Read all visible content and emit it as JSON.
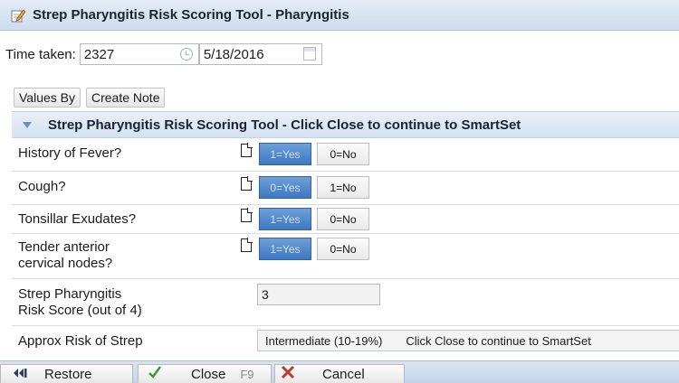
{
  "window": {
    "title": "Strep Pharyngitis Risk Scoring Tool - Pharyngitis"
  },
  "time": {
    "label": "Time taken:",
    "time_value": "2327",
    "date_value": "5/18/2016"
  },
  "toolbar": {
    "values_by": "Values By",
    "create_note": "Create Note"
  },
  "section": {
    "title": "Strep Pharyngitis Risk Scoring Tool - Click Close to continue to SmartSet"
  },
  "questions": [
    {
      "label": "History of Fever?",
      "opt1": "1=Yes",
      "opt2": "0=No",
      "selected": "opt1"
    },
    {
      "label": "Cough?",
      "opt1": "0=Yes",
      "opt2": "1=No",
      "selected": "opt1"
    },
    {
      "label": "Tonsillar Exudates?",
      "opt1": "1=Yes",
      "opt2": "0=No",
      "selected": "opt1"
    },
    {
      "label_line1": "Tender anterior",
      "label_line2": "cervical nodes?",
      "opt1": "1=Yes",
      "opt2": "0=No",
      "selected": "opt1"
    }
  ],
  "score": {
    "label_line1": "Strep Pharyngitis",
    "label_line2": "Risk Score (out of 4)",
    "value": "3"
  },
  "risk": {
    "label": "Approx Risk of Strep",
    "value": "Intermediate (10-19%)",
    "note": "Click Close to continue to SmartSet"
  },
  "footer": {
    "restore": "Restore",
    "close": "Close",
    "close_shortcut": "F9",
    "cancel": "Cancel"
  },
  "colors": {
    "selected_option": "#3e78c0",
    "titlebar": "#cddcee",
    "cancel_icon": "#c0392b",
    "close_icon": "#3a9a3a"
  }
}
